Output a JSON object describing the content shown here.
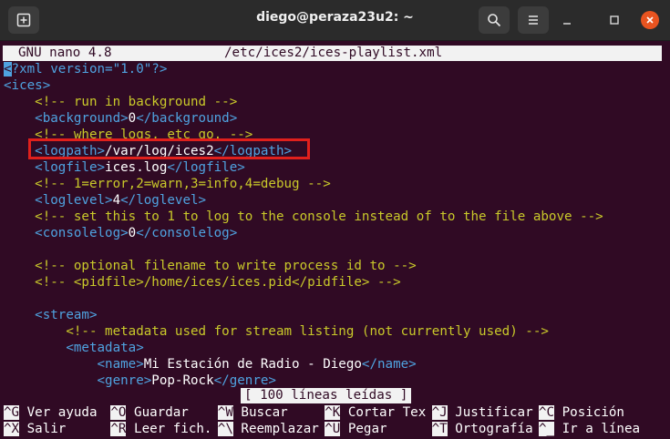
{
  "window": {
    "title": "diego@peraza23u2: ~",
    "icons": {
      "new_tab": "new-tab-icon",
      "search": "search-icon",
      "menu": "hamburger-menu-icon",
      "minimize": "minimize-icon",
      "maximize": "maximize-icon",
      "close": "close-icon"
    }
  },
  "nano": {
    "version": "GNU nano 4.8",
    "filename": "/etc/ices2/ices-playlist.xml"
  },
  "lines": [
    {
      "indent": "",
      "parts": [
        [
          "cursor",
          "<"
        ],
        [
          "pi",
          "?xml version=\"1.0\"?>"
        ]
      ]
    },
    {
      "indent": "",
      "parts": [
        [
          "tag",
          "<ices>"
        ]
      ]
    },
    {
      "indent": "    ",
      "parts": [
        [
          "cm",
          "<!-- run in background -->"
        ]
      ]
    },
    {
      "indent": "    ",
      "parts": [
        [
          "tag",
          "<background>"
        ],
        [
          "val",
          "0"
        ],
        [
          "tag",
          "</background>"
        ]
      ]
    },
    {
      "indent": "    ",
      "parts": [
        [
          "cm",
          "<!-- where logs, etc go. -->"
        ]
      ]
    },
    {
      "indent": "    ",
      "parts": [
        [
          "tag",
          "<logpath>"
        ],
        [
          "val",
          "/var/log/ices2"
        ],
        [
          "tag",
          "</logpath>"
        ]
      ]
    },
    {
      "indent": "    ",
      "parts": [
        [
          "tag",
          "<logfile>"
        ],
        [
          "val",
          "ices.log"
        ],
        [
          "tag",
          "</logfile>"
        ]
      ]
    },
    {
      "indent": "    ",
      "parts": [
        [
          "cm",
          "<!-- 1=error,2=warn,3=info,4=debug -->"
        ]
      ]
    },
    {
      "indent": "    ",
      "parts": [
        [
          "tag",
          "<loglevel>"
        ],
        [
          "val",
          "4"
        ],
        [
          "tag",
          "</loglevel>"
        ]
      ]
    },
    {
      "indent": "    ",
      "parts": [
        [
          "cm",
          "<!-- set this to 1 to log to the console instead of to the file above -->"
        ]
      ]
    },
    {
      "indent": "    ",
      "parts": [
        [
          "tag",
          "<consolelog>"
        ],
        [
          "val",
          "0"
        ],
        [
          "tag",
          "</consolelog>"
        ]
      ]
    },
    {
      "indent": "",
      "parts": []
    },
    {
      "indent": "    ",
      "parts": [
        [
          "cm",
          "<!-- optional filename to write process id to -->"
        ]
      ]
    },
    {
      "indent": "    ",
      "parts": [
        [
          "cm",
          "<!-- <pidfile>/home/ices/ices.pid</pidfile> -->"
        ]
      ]
    },
    {
      "indent": "",
      "parts": []
    },
    {
      "indent": "    ",
      "parts": [
        [
          "tag",
          "<stream>"
        ]
      ]
    },
    {
      "indent": "        ",
      "parts": [
        [
          "cm",
          "<!-- metadata used for stream listing (not currently used) -->"
        ]
      ]
    },
    {
      "indent": "        ",
      "parts": [
        [
          "tag",
          "<metadata>"
        ]
      ]
    },
    {
      "indent": "            ",
      "parts": [
        [
          "tag",
          "<name>"
        ],
        [
          "val",
          "Mi Estación de Radio - Diego"
        ],
        [
          "tag",
          "</name>"
        ]
      ]
    },
    {
      "indent": "            ",
      "parts": [
        [
          "tag",
          "<genre>"
        ],
        [
          "val",
          "Pop-Rock"
        ],
        [
          "tag",
          "</genre>"
        ]
      ]
    }
  ],
  "status": "[ 100 líneas leídas ]",
  "shortcuts_row1": [
    {
      "key": "^G",
      "label": "Ver ayuda"
    },
    {
      "key": "^O",
      "label": "Guardar"
    },
    {
      "key": "^W",
      "label": "Buscar"
    },
    {
      "key": "^K",
      "label": "Cortar Tex"
    },
    {
      "key": "^J",
      "label": "Justificar"
    },
    {
      "key": "^C",
      "label": "Posición"
    }
  ],
  "shortcuts_row2": [
    {
      "key": "^X",
      "label": "Salir"
    },
    {
      "key": "^R",
      "label": "Leer fich."
    },
    {
      "key": "^\\",
      "label": "Reemplazar"
    },
    {
      "key": "^U",
      "label": "Pegar"
    },
    {
      "key": "^T",
      "label": "Ortografía"
    },
    {
      "key": "^_",
      "label": "Ir a línea"
    }
  ]
}
